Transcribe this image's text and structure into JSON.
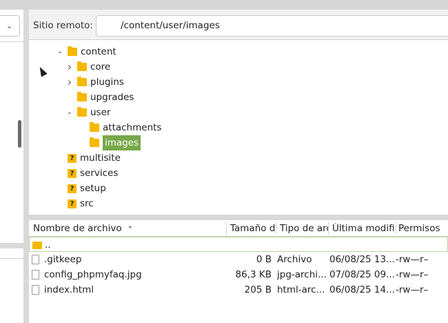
{
  "remote": {
    "label": "Sitio remoto:",
    "path": "/content/user/images"
  },
  "tree": [
    {
      "name": "content",
      "expander": "open",
      "icon": "folder-icon",
      "selected": false
    },
    {
      "name": "core",
      "expander": "closed",
      "icon": "folder-icon",
      "selected": false
    },
    {
      "name": "plugins",
      "expander": "closed",
      "icon": "folder-icon",
      "selected": false
    },
    {
      "name": "upgrades",
      "expander": "none",
      "icon": "folder-icon",
      "selected": false
    },
    {
      "name": "user",
      "expander": "open",
      "icon": "folder-icon",
      "selected": false
    },
    {
      "name": "attachments",
      "expander": "none",
      "icon": "folder-icon",
      "selected": false
    },
    {
      "name": "images",
      "expander": "none",
      "icon": "folder-icon",
      "selected": true
    },
    {
      "name": "multisite",
      "expander": "none",
      "icon": "unknown-folder-icon",
      "selected": false
    },
    {
      "name": "services",
      "expander": "none",
      "icon": "unknown-folder-icon",
      "selected": false
    },
    {
      "name": "setup",
      "expander": "none",
      "icon": "unknown-folder-icon",
      "selected": false
    },
    {
      "name": "src",
      "expander": "none",
      "icon": "unknown-folder-icon",
      "selected": false
    }
  ],
  "list": {
    "columns": {
      "name": "Nombre de archivo",
      "size": "Tamaño de",
      "type": "Tipo de arc",
      "modified": "Última modifi",
      "perms": "Permisos"
    },
    "rows": [
      {
        "name": "..",
        "size": "",
        "type": "",
        "modified": "",
        "perms": "",
        "icon": "folder-icon"
      },
      {
        "name": ".gitkeep",
        "size": "0 B",
        "type": "Archivo",
        "modified": "06/08/25 13...",
        "perms": "-rw—r–",
        "icon": "file-icon"
      },
      {
        "name": "config_phpmyfaq.jpg",
        "size": "86,3 KB",
        "type": "jpg-archi...",
        "modified": "07/08/25 09...",
        "perms": "-rw—r–",
        "icon": "file-icon"
      },
      {
        "name": "index.html",
        "size": "205 B",
        "type": "html-arc...",
        "modified": "06/08/25 14...",
        "perms": "-rw—r–",
        "icon": "file-icon"
      }
    ]
  },
  "colors": {
    "folder": "#f5b800",
    "selection": "#77a84a"
  },
  "glyphs": {
    "unknown": "?",
    "sort": "⌃",
    "combo": "⌄"
  }
}
